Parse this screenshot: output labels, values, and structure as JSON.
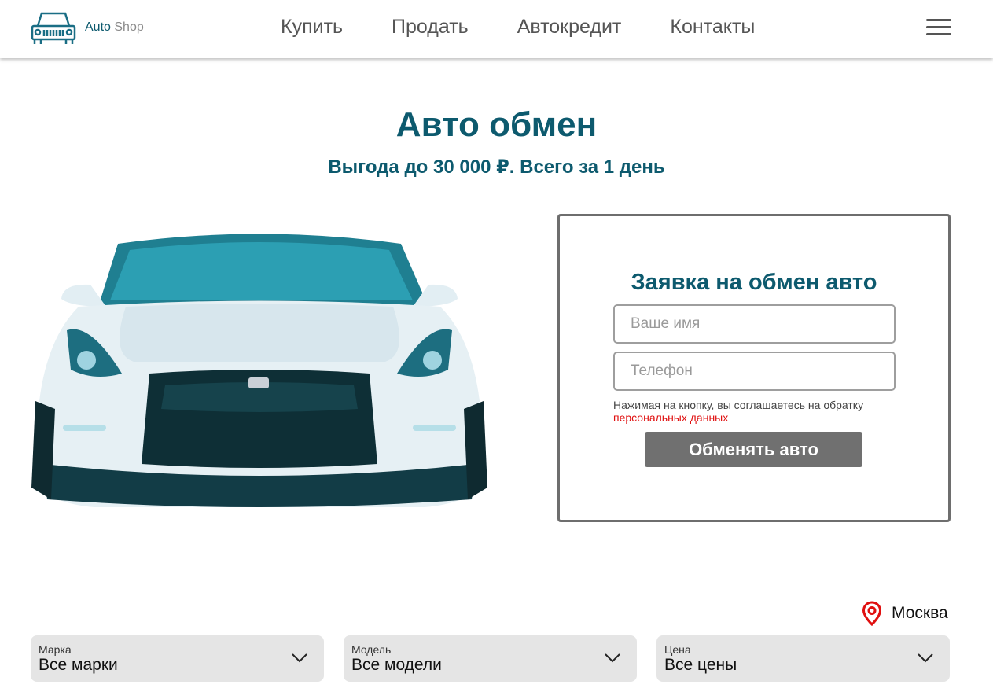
{
  "header": {
    "logo_word_1": "Auto",
    "logo_word_2": "Shop",
    "nav": [
      "Купить",
      "Продать",
      "Автокредит",
      "Контакты"
    ],
    "menu_icon": "hamburger-icon"
  },
  "hero": {
    "title": "Авто обмен",
    "subtitle": "Выгода до 30 000 ₽. Всего за 1 день",
    "image": "white-sports-car-front-view"
  },
  "form": {
    "title": "Заявка на обмен авто",
    "name_placeholder": "Ваше имя",
    "phone_placeholder": "Телефон",
    "consent_text": "Нажимая на кнопку, вы соглашаетесь на обратку",
    "consent_link": "персональных данных",
    "submit_label": "Обменять авто"
  },
  "location": {
    "icon": "map-pin-icon",
    "city": "Москва"
  },
  "filters": [
    {
      "label": "Марка",
      "value": "Все марки"
    },
    {
      "label": "Модель",
      "value": "Все модели"
    },
    {
      "label": "Цена",
      "value": "Все цены"
    }
  ],
  "colors": {
    "brand": "#0d5a6e",
    "muted_text": "#555555",
    "button": "#707070",
    "link": "#e01010",
    "filter_bg": "#e5e5e5"
  }
}
